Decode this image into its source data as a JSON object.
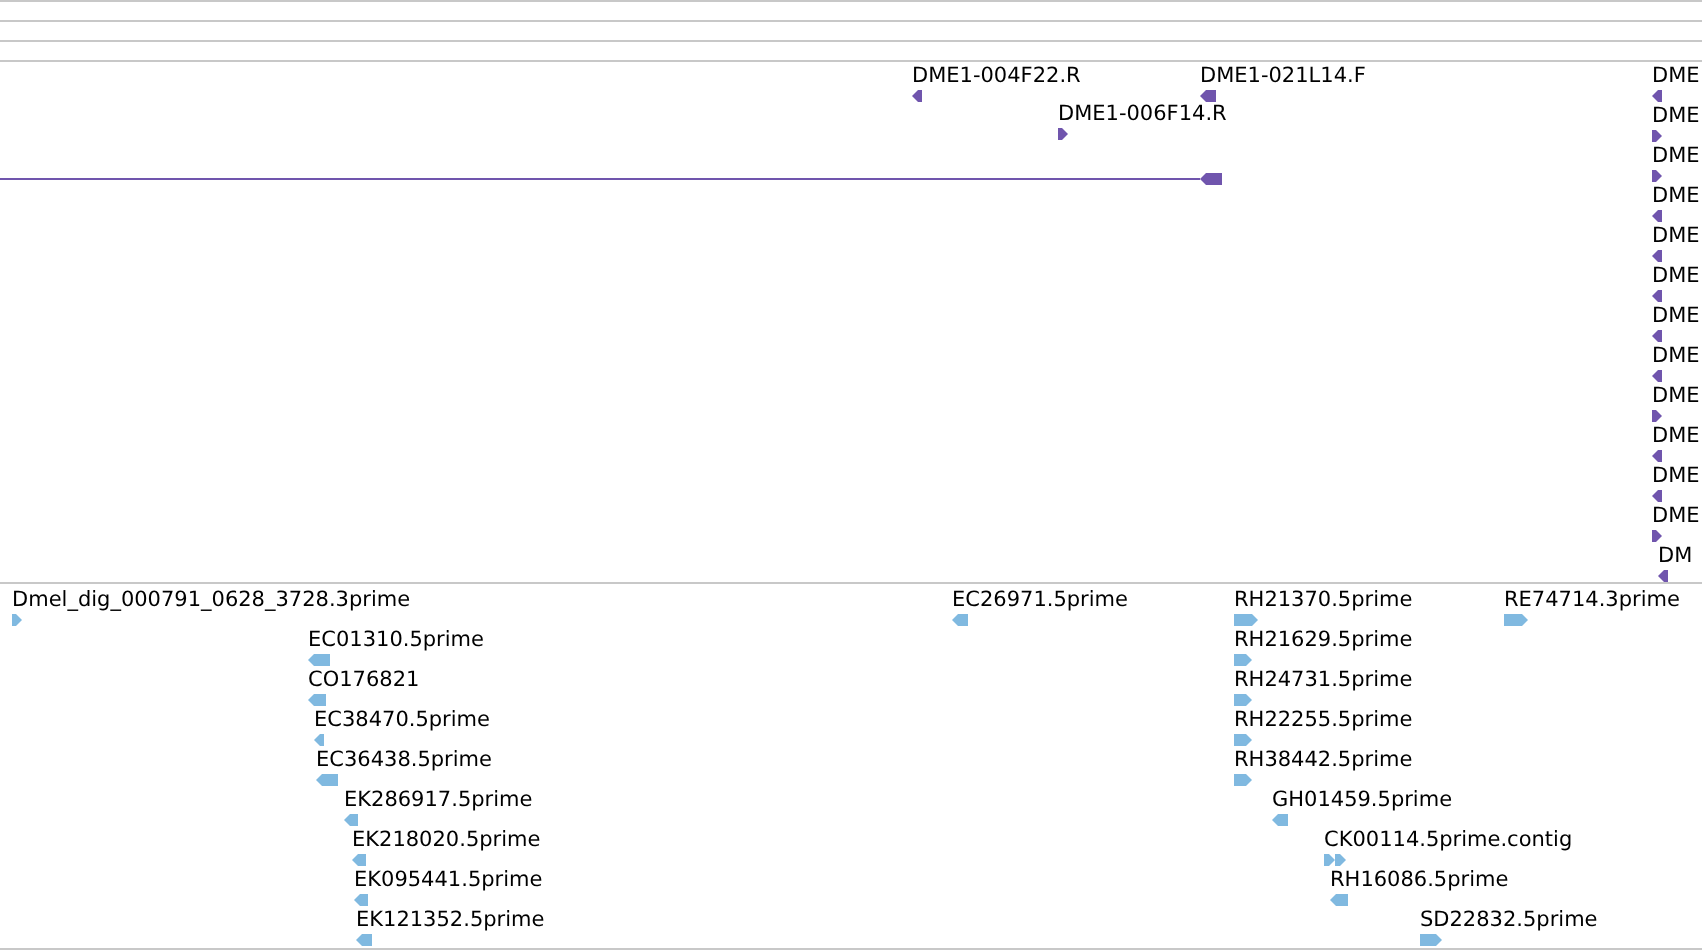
{
  "tracks": [
    {
      "color": "#7055ad",
      "features": [
        {
          "kind": "arrow",
          "label": "DME1-004F22.R",
          "reverse": true
        },
        {
          "kind": "arrow",
          "label": "DME1-021L14.F",
          "reverse": true
        },
        {
          "kind": "arrow",
          "label": "DME1-006F14.R",
          "reverse": false
        },
        {
          "kind": "line",
          "reverse": true
        },
        {
          "kind": "arrow",
          "label": "DME",
          "reverse": true
        },
        {
          "kind": "arrow",
          "label": "DME",
          "reverse": false
        },
        {
          "kind": "arrow",
          "label": "DME",
          "reverse": false
        },
        {
          "kind": "arrow",
          "label": "DME",
          "reverse": true
        },
        {
          "kind": "arrow",
          "label": "DME",
          "reverse": true
        },
        {
          "kind": "arrow",
          "label": "DME",
          "reverse": true
        },
        {
          "kind": "arrow",
          "label": "DME",
          "reverse": true
        },
        {
          "kind": "arrow",
          "label": "DME",
          "reverse": true
        },
        {
          "kind": "arrow",
          "label": "DME",
          "reverse": false
        },
        {
          "kind": "arrow",
          "label": "DME",
          "reverse": true
        },
        {
          "kind": "arrow",
          "label": "DME",
          "reverse": true
        },
        {
          "kind": "arrow",
          "label": "DME",
          "reverse": false
        },
        {
          "kind": "arrow",
          "label": "DM",
          "reverse": true
        }
      ]
    },
    {
      "color": "#80b9e0",
      "features": [
        {
          "kind": "arrow",
          "label": "Dmel_dig_000791_0628_3728.3prime",
          "reverse": false
        },
        {
          "kind": "arrow",
          "label": "EC01310.5prime",
          "reverse": true
        },
        {
          "kind": "arrow",
          "label": "CO176821",
          "reverse": true
        },
        {
          "kind": "arrow",
          "label": "EC38470.5prime",
          "reverse": true
        },
        {
          "kind": "arrow",
          "label": "EC36438.5prime",
          "reverse": true
        },
        {
          "kind": "arrow",
          "label": "EK286917.5prime",
          "reverse": true
        },
        {
          "kind": "arrow",
          "label": "EK218020.5prime",
          "reverse": true
        },
        {
          "kind": "arrow",
          "label": "EK095441.5prime",
          "reverse": true
        },
        {
          "kind": "arrow",
          "label": "EK121352.5prime",
          "reverse": true
        },
        {
          "kind": "arrow",
          "label": "EC26971.5prime",
          "reverse": true
        },
        {
          "kind": "arrow",
          "label": "RH21370.5prime",
          "reverse": false
        },
        {
          "kind": "arrow",
          "label": "RH21629.5prime",
          "reverse": false
        },
        {
          "kind": "arrow",
          "label": "RH24731.5prime",
          "reverse": false
        },
        {
          "kind": "arrow",
          "label": "RH22255.5prime",
          "reverse": false
        },
        {
          "kind": "arrow",
          "label": "RH38442.5prime",
          "reverse": false
        },
        {
          "kind": "arrow",
          "label": "GH01459.5prime",
          "reverse": true
        },
        {
          "kind": "double-arrow",
          "label": "CK00114.5prime.contig",
          "reverse": false
        },
        {
          "kind": "arrow",
          "label": "RH16086.5prime",
          "reverse": true
        },
        {
          "kind": "arrow",
          "label": "SD22832.5prime",
          "reverse": false
        },
        {
          "kind": "arrow",
          "label": "RE74714.3prime",
          "reverse": false
        }
      ]
    }
  ]
}
